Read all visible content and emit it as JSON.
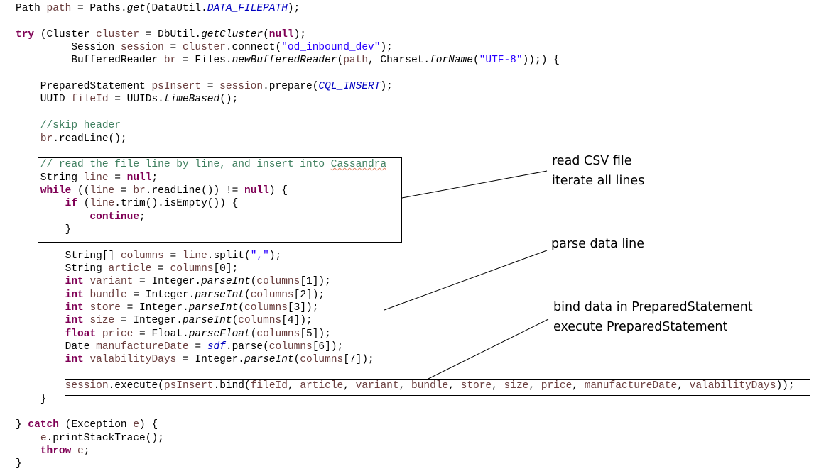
{
  "code_lines": [
    [
      [
        "p",
        "Path "
      ],
      [
        "v",
        "path"
      ],
      [
        "p",
        " = Paths."
      ],
      [
        "i",
        "get"
      ],
      [
        "p",
        "(DataUtil."
      ],
      [
        "f",
        "DATA_FILEPATH"
      ],
      [
        "p",
        ");"
      ]
    ],
    [],
    [
      [
        "k",
        "try"
      ],
      [
        "p",
        " (Cluster "
      ],
      [
        "v",
        "cluster"
      ],
      [
        "p",
        " = DbUtil."
      ],
      [
        "i",
        "getCluster"
      ],
      [
        "p",
        "("
      ],
      [
        "k",
        "null"
      ],
      [
        "p",
        ");"
      ]
    ],
    [
      [
        "p",
        "         Session "
      ],
      [
        "v",
        "session"
      ],
      [
        "p",
        " = "
      ],
      [
        "v",
        "cluster"
      ],
      [
        "p",
        ".connect("
      ],
      [
        "s",
        "\"od_inbound_dev\""
      ],
      [
        "p",
        ");"
      ]
    ],
    [
      [
        "p",
        "         BufferedReader "
      ],
      [
        "v",
        "br"
      ],
      [
        "p",
        " = Files."
      ],
      [
        "i",
        "newBufferedReader"
      ],
      [
        "p",
        "("
      ],
      [
        "v",
        "path"
      ],
      [
        "p",
        ", Charset."
      ],
      [
        "i",
        "forName"
      ],
      [
        "p",
        "("
      ],
      [
        "s",
        "\"UTF-8\""
      ],
      [
        "p",
        "));) {"
      ]
    ],
    [],
    [
      [
        "p",
        "    PreparedStatement "
      ],
      [
        "v",
        "psInsert"
      ],
      [
        "p",
        " = "
      ],
      [
        "v",
        "session"
      ],
      [
        "p",
        ".prepare("
      ],
      [
        "f",
        "CQL_INSERT"
      ],
      [
        "p",
        ");"
      ]
    ],
    [
      [
        "p",
        "    UUID "
      ],
      [
        "v",
        "fileId"
      ],
      [
        "p",
        " = UUIDs."
      ],
      [
        "i",
        "timeBased"
      ],
      [
        "p",
        "();"
      ]
    ],
    [],
    [
      [
        "c",
        "    //skip header"
      ]
    ],
    [
      [
        "p",
        "    "
      ],
      [
        "v",
        "br"
      ],
      [
        "p",
        ".readLine();"
      ]
    ],
    [],
    [
      [
        "c",
        "    // read the file line by line, and insert into "
      ],
      [
        "u",
        "Cassandra"
      ]
    ],
    [
      [
        "p",
        "    String "
      ],
      [
        "v",
        "line"
      ],
      [
        "p",
        " = "
      ],
      [
        "k",
        "null"
      ],
      [
        "p",
        ";"
      ]
    ],
    [
      [
        "p",
        "    "
      ],
      [
        "k",
        "while"
      ],
      [
        "p",
        " (("
      ],
      [
        "v",
        "line"
      ],
      [
        "p",
        " = "
      ],
      [
        "v",
        "br"
      ],
      [
        "p",
        ".readLine()) != "
      ],
      [
        "k",
        "null"
      ],
      [
        "p",
        ") {"
      ]
    ],
    [
      [
        "p",
        "        "
      ],
      [
        "k",
        "if"
      ],
      [
        "p",
        " ("
      ],
      [
        "v",
        "line"
      ],
      [
        "p",
        ".trim().isEmpty()) {"
      ]
    ],
    [
      [
        "p",
        "            "
      ],
      [
        "k",
        "continue"
      ],
      [
        "p",
        ";"
      ]
    ],
    [
      [
        "p",
        "        }"
      ]
    ],
    [],
    [
      [
        "p",
        "        String[] "
      ],
      [
        "v",
        "columns"
      ],
      [
        "p",
        " = "
      ],
      [
        "v",
        "line"
      ],
      [
        "p",
        ".split("
      ],
      [
        "s",
        "\",\""
      ],
      [
        "p",
        ");"
      ]
    ],
    [
      [
        "p",
        "        String "
      ],
      [
        "v",
        "article"
      ],
      [
        "p",
        " = "
      ],
      [
        "v",
        "columns"
      ],
      [
        "p",
        "[0];"
      ]
    ],
    [
      [
        "p",
        "        "
      ],
      [
        "k",
        "int"
      ],
      [
        "p",
        " "
      ],
      [
        "v",
        "variant"
      ],
      [
        "p",
        " = Integer."
      ],
      [
        "i",
        "parseInt"
      ],
      [
        "p",
        "("
      ],
      [
        "v",
        "columns"
      ],
      [
        "p",
        "[1]);"
      ]
    ],
    [
      [
        "p",
        "        "
      ],
      [
        "k",
        "int"
      ],
      [
        "p",
        " "
      ],
      [
        "v",
        "bundle"
      ],
      [
        "p",
        " = Integer."
      ],
      [
        "i",
        "parseInt"
      ],
      [
        "p",
        "("
      ],
      [
        "v",
        "columns"
      ],
      [
        "p",
        "[2]);"
      ]
    ],
    [
      [
        "p",
        "        "
      ],
      [
        "k",
        "int"
      ],
      [
        "p",
        " "
      ],
      [
        "v",
        "store"
      ],
      [
        "p",
        " = Integer."
      ],
      [
        "i",
        "parseInt"
      ],
      [
        "p",
        "("
      ],
      [
        "v",
        "columns"
      ],
      [
        "p",
        "[3]);"
      ]
    ],
    [
      [
        "p",
        "        "
      ],
      [
        "k",
        "int"
      ],
      [
        "p",
        " "
      ],
      [
        "v",
        "size"
      ],
      [
        "p",
        " = Integer."
      ],
      [
        "i",
        "parseInt"
      ],
      [
        "p",
        "("
      ],
      [
        "v",
        "columns"
      ],
      [
        "p",
        "[4]);"
      ]
    ],
    [
      [
        "p",
        "        "
      ],
      [
        "k",
        "float"
      ],
      [
        "p",
        " "
      ],
      [
        "v",
        "price"
      ],
      [
        "p",
        " = Float."
      ],
      [
        "i",
        "parseFloat"
      ],
      [
        "p",
        "("
      ],
      [
        "v",
        "columns"
      ],
      [
        "p",
        "[5]);"
      ]
    ],
    [
      [
        "p",
        "        Date "
      ],
      [
        "v",
        "manufactureDate"
      ],
      [
        "p",
        " = "
      ],
      [
        "f",
        "sdf"
      ],
      [
        "p",
        ".parse("
      ],
      [
        "v",
        "columns"
      ],
      [
        "p",
        "[6]);"
      ]
    ],
    [
      [
        "p",
        "        "
      ],
      [
        "k",
        "int"
      ],
      [
        "p",
        " "
      ],
      [
        "v",
        "valabilityDays"
      ],
      [
        "p",
        " = Integer."
      ],
      [
        "i",
        "parseInt"
      ],
      [
        "p",
        "("
      ],
      [
        "v",
        "columns"
      ],
      [
        "p",
        "[7]);"
      ]
    ],
    [],
    [
      [
        "p",
        "        "
      ],
      [
        "v",
        "session"
      ],
      [
        "p",
        ".execute("
      ],
      [
        "v",
        "psInsert"
      ],
      [
        "p",
        ".bind("
      ],
      [
        "v",
        "fileId"
      ],
      [
        "p",
        ", "
      ],
      [
        "v",
        "article"
      ],
      [
        "p",
        ", "
      ],
      [
        "v",
        "variant"
      ],
      [
        "p",
        ", "
      ],
      [
        "v",
        "bundle"
      ],
      [
        "p",
        ", "
      ],
      [
        "v",
        "store"
      ],
      [
        "p",
        ", "
      ],
      [
        "v",
        "size"
      ],
      [
        "p",
        ", "
      ],
      [
        "v",
        "price"
      ],
      [
        "p",
        ", "
      ],
      [
        "v",
        "manufactureDate"
      ],
      [
        "p",
        ", "
      ],
      [
        "v",
        "valabilityDays"
      ],
      [
        "p",
        "));"
      ]
    ],
    [
      [
        "p",
        "    }"
      ]
    ],
    [],
    [
      [
        "p",
        "} "
      ],
      [
        "k",
        "catch"
      ],
      [
        "p",
        " (Exception "
      ],
      [
        "v",
        "e"
      ],
      [
        "p",
        ") {"
      ]
    ],
    [
      [
        "p",
        "    "
      ],
      [
        "v",
        "e"
      ],
      [
        "p",
        ".printStackTrace();"
      ]
    ],
    [
      [
        "p",
        "    "
      ],
      [
        "k",
        "throw"
      ],
      [
        "p",
        " "
      ],
      [
        "v",
        "e"
      ],
      [
        "p",
        ";"
      ]
    ],
    [
      [
        "p",
        "}"
      ]
    ]
  ],
  "annotations": {
    "read_loop": [
      "read CSV file",
      "iterate all lines"
    ],
    "parse": [
      "parse data line"
    ],
    "bind": [
      "bind data in PreparedStatement",
      "execute PreparedStatement"
    ]
  },
  "colors": {
    "keyword": "#7f0055",
    "variable": "#6a3e3e",
    "string": "#2a00ff",
    "comment": "#3f7f5f",
    "static_field": "#0000c0"
  }
}
